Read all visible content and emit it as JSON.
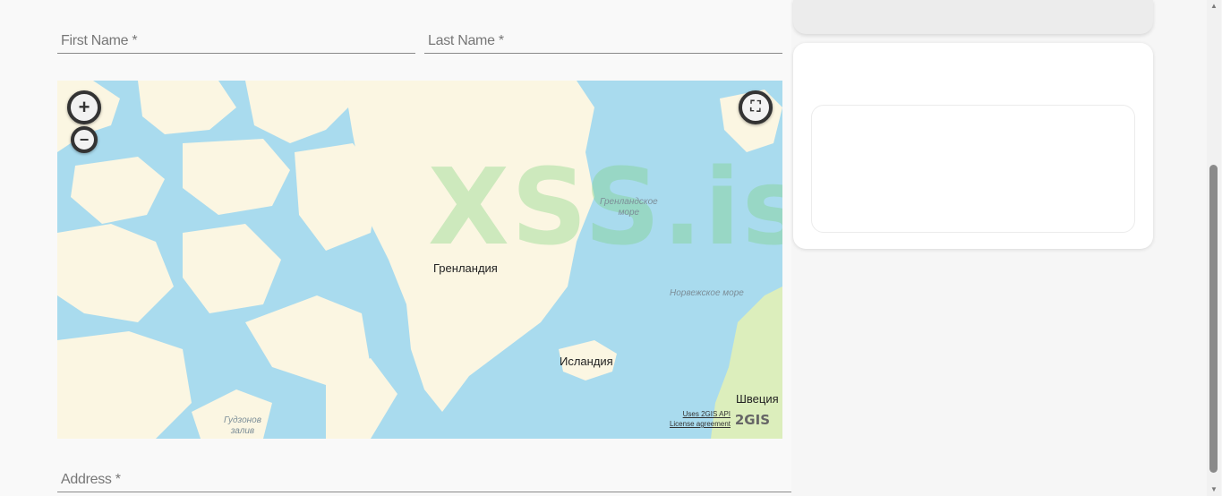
{
  "form": {
    "first_name_placeholder": "First Name *",
    "last_name_placeholder": "Last Name *",
    "address_placeholder": "Address *"
  },
  "map": {
    "zoom_in_symbol": "+",
    "zoom_out_symbol": "−",
    "fullscreen_symbol": "⛶",
    "labels": {
      "greenland": "Гренландия",
      "iceland": "Исландия",
      "sweden": "Швеция",
      "greenland_sea_line1": "Гренландское",
      "greenland_sea_line2": "море",
      "norwegian_sea": "Норвежское море",
      "hudson_bay_line1": "Гудзонов",
      "hudson_bay_line2": "залив"
    },
    "watermark": "XSS.is",
    "attribution": {
      "api_link": "Uses 2GIS API",
      "license_link": "License agreement",
      "logo": "2GIS"
    },
    "colors": {
      "water": "#a9dbee",
      "land": "#fbf6e2",
      "forest": "#dceebc"
    }
  },
  "scrollbar": {
    "up_arrow": "▲",
    "down_arrow": "▼"
  }
}
